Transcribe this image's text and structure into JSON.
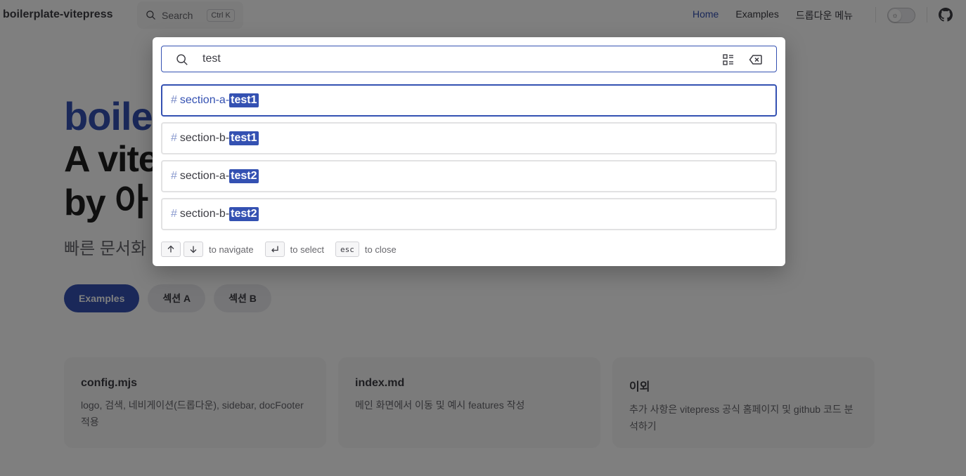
{
  "nav": {
    "title": "boilerplate-vitepress",
    "search_label": "Search",
    "search_kbd": "Ctrl K",
    "links": [
      "Home",
      "Examples",
      "드롭다운 메뉴"
    ],
    "theme_icon": "sun-icon",
    "social_icon": "github-icon",
    "accent": "#3451b2"
  },
  "hero": {
    "name_visible": "boile",
    "text_line1_visible": "A vite",
    "text_line2_visible": "by 아",
    "tagline_visible": "빠른 문서화",
    "actions": [
      "Examples",
      "섹션 A",
      "섹션 B"
    ]
  },
  "features": [
    {
      "title": "config.mjs",
      "details": "logo, 검색, 네비게이션(드롭다운), sidebar, docFooter 적용"
    },
    {
      "title": "index.md",
      "details": "메인 화면에서 이동 및 예시 features 작성"
    },
    {
      "title": "이외",
      "details": "추가 사항은 vitepress 공식 홈페이지 및 github 코드 분석하기"
    }
  ],
  "search": {
    "query": "test",
    "results": [
      {
        "hash": "#",
        "prefix": "section-a-",
        "match": "test1",
        "selected": true
      },
      {
        "hash": "#",
        "prefix": "section-b-",
        "match": "test1",
        "selected": false
      },
      {
        "hash": "#",
        "prefix": "section-a-",
        "match": "test2",
        "selected": false
      },
      {
        "hash": "#",
        "prefix": "section-b-",
        "match": "test2",
        "selected": false
      }
    ],
    "footer": {
      "navigate_label": "to navigate",
      "select_label": "to select",
      "close_kbd": "esc",
      "close_label": "to close"
    }
  }
}
